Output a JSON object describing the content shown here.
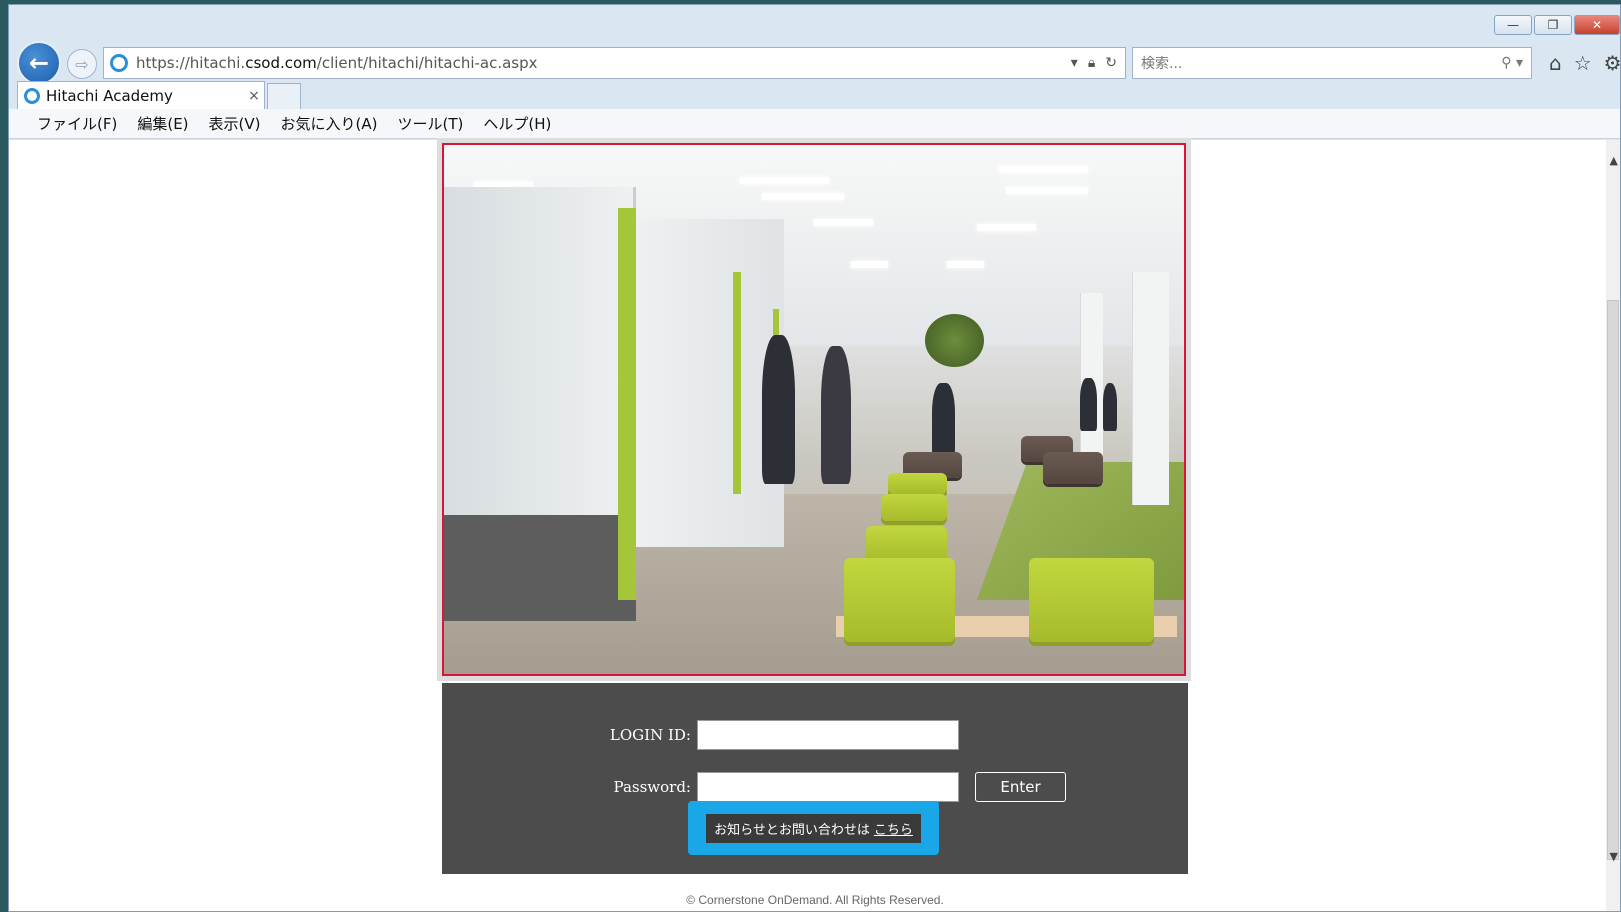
{
  "window": {
    "minimize": "—",
    "maximize": "❐",
    "close": "✕"
  },
  "nav": {
    "back_icon": "arrow-left-icon",
    "forward_icon": "arrow-right-icon",
    "url_prefix": "https://hitachi.",
    "url_domain": "csod.com",
    "url_path": "/client/hitachi/hitachi-ac.aspx",
    "search_placeholder": "検索..."
  },
  "tab": {
    "title": "Hitachi Academy",
    "close": "×"
  },
  "menu": {
    "items": [
      {
        "label": "ファイル(F)"
      },
      {
        "label": "編集(E)"
      },
      {
        "label": "表示(V)"
      },
      {
        "label": "お気に入り(A)"
      },
      {
        "label": "ツール(T)"
      },
      {
        "label": "ヘルプ(H)"
      }
    ]
  },
  "login": {
    "id_label": "LOGIN ID:",
    "password_label": "Password:",
    "login_id_value": "",
    "password_value": "",
    "enter_label": "Enter",
    "notice_text": "お知らせとお問い合わせは",
    "notice_link": "こちら"
  },
  "footer": {
    "text": "© Cornerstone OnDemand. All Rights Reserved."
  },
  "colors": {
    "panel_bg": "#4c4c4c",
    "notice_border": "#19a7e8",
    "hero_border": "#d9153a"
  }
}
